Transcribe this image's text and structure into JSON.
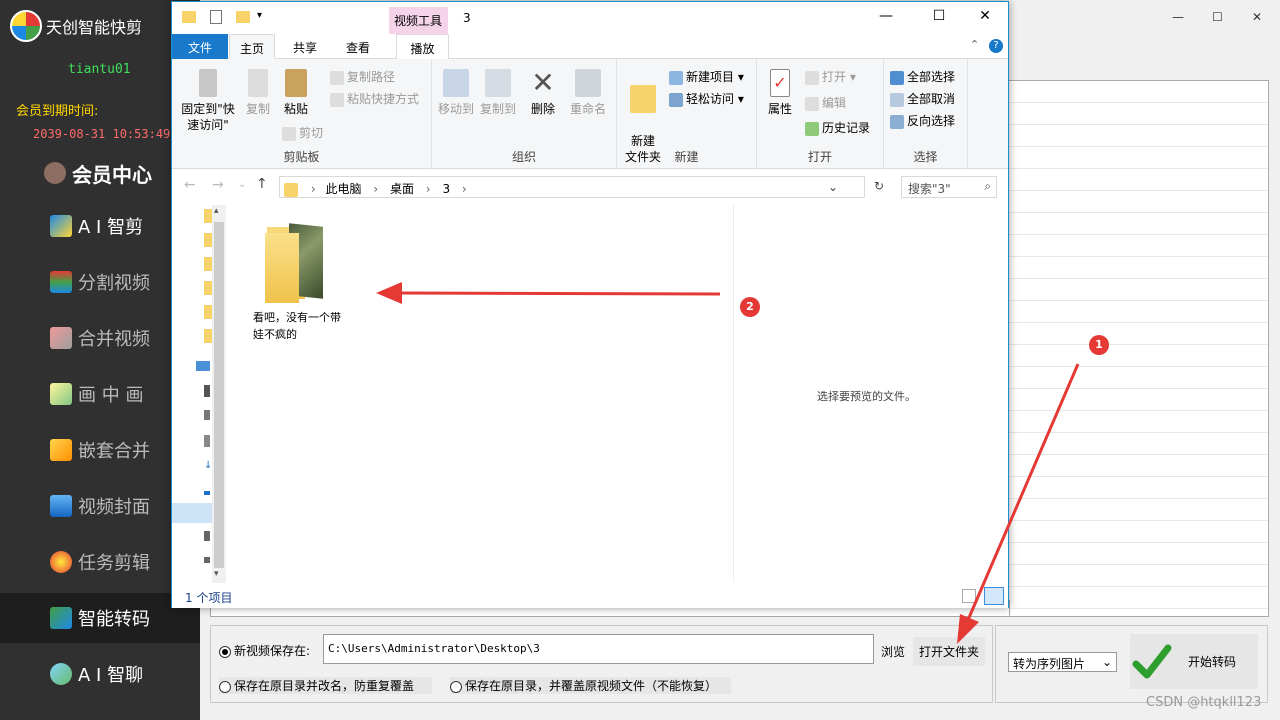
{
  "app": {
    "title": "天创智能快剪",
    "username": "tiantu01",
    "member_label": "会员到期时间:",
    "expire_time": "2039-08-31 10:53:49",
    "vip_center": "会员中心",
    "nav": [
      {
        "label": "A I 智剪",
        "icon": "ai-edit-icon"
      },
      {
        "label": "分割视频",
        "icon": "split-icon"
      },
      {
        "label": "合并视频",
        "icon": "merge-icon"
      },
      {
        "label": "画 中 画",
        "icon": "pip-icon"
      },
      {
        "label": "嵌套合并",
        "icon": "nest-icon"
      },
      {
        "label": "视频封面",
        "icon": "cover-icon"
      },
      {
        "label": "任务剪辑",
        "icon": "task-icon"
      },
      {
        "label": "智能转码",
        "icon": "transcode-icon"
      },
      {
        "label": "A I 智聊",
        "icon": "chat-icon"
      }
    ],
    "active_nav": "智能转码",
    "window_controls": {
      "minimize": "—",
      "maximize": "☐",
      "close": "✕"
    }
  },
  "bottom": {
    "save_new_label": "新视频保存在:",
    "path": "C:\\Users\\Administrator\\Desktop\\3",
    "browse": "浏览",
    "open_folder": "打开文件夹",
    "option_rename": "保存在原目录并改名，防重复覆盖",
    "option_overwrite": "保存在原目录，并覆盖原视频文件（不能恢复）",
    "format_selected": "转为序列图片",
    "start": "开始转码"
  },
  "explorer": {
    "video_tools": "视频工具",
    "title": "3",
    "tabs": {
      "file": "文件",
      "home": "主页",
      "share": "共享",
      "view": "查看",
      "play": "播放"
    },
    "clipboard": {
      "pin": "固定到\"快速访问\"",
      "copy": "复制",
      "paste": "粘贴",
      "copy_path": "复制路径",
      "paste_shortcut": "粘贴快捷方式",
      "cut": "剪切",
      "label": "剪贴板"
    },
    "organize": {
      "move_to": "移动到",
      "copy_to": "复制到",
      "delete": "删除",
      "rename": "重命名",
      "label": "组织"
    },
    "new": {
      "new_folder": "新建\n文件夹",
      "new_item": "新建项目",
      "easy_access": "轻松访问",
      "label": "新建"
    },
    "open": {
      "properties": "属性",
      "open": "打开",
      "edit": "编辑",
      "history": "历史记录",
      "label": "打开"
    },
    "select": {
      "select_all": "全部选择",
      "select_none": "全部取消",
      "invert": "反向选择",
      "label": "选择"
    },
    "breadcrumb": [
      "此电脑",
      "桌面",
      "3"
    ],
    "search_placeholder": "搜索\"3\"",
    "file_name": "看吧，没有一个带娃不疯的",
    "preview_text": "选择要预览的文件。",
    "status": "1 个项目"
  },
  "annotations": {
    "one": "1",
    "two": "2"
  },
  "watermark": "CSDN @htqkll123"
}
